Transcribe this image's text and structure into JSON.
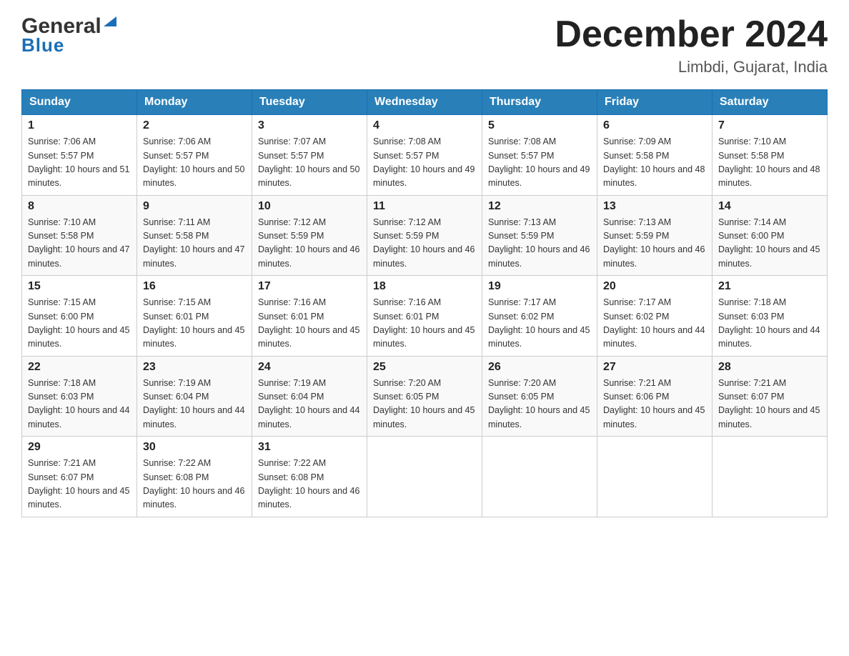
{
  "header": {
    "logo": {
      "general": "General",
      "blue": "Blue"
    },
    "month_title": "December 2024",
    "location": "Limbdi, Gujarat, India"
  },
  "days_of_week": [
    "Sunday",
    "Monday",
    "Tuesday",
    "Wednesday",
    "Thursday",
    "Friday",
    "Saturday"
  ],
  "weeks": [
    [
      {
        "day": "1",
        "sunrise": "7:06 AM",
        "sunset": "5:57 PM",
        "daylight": "10 hours and 51 minutes."
      },
      {
        "day": "2",
        "sunrise": "7:06 AM",
        "sunset": "5:57 PM",
        "daylight": "10 hours and 50 minutes."
      },
      {
        "day": "3",
        "sunrise": "7:07 AM",
        "sunset": "5:57 PM",
        "daylight": "10 hours and 50 minutes."
      },
      {
        "day": "4",
        "sunrise": "7:08 AM",
        "sunset": "5:57 PM",
        "daylight": "10 hours and 49 minutes."
      },
      {
        "day": "5",
        "sunrise": "7:08 AM",
        "sunset": "5:57 PM",
        "daylight": "10 hours and 49 minutes."
      },
      {
        "day": "6",
        "sunrise": "7:09 AM",
        "sunset": "5:58 PM",
        "daylight": "10 hours and 48 minutes."
      },
      {
        "day": "7",
        "sunrise": "7:10 AM",
        "sunset": "5:58 PM",
        "daylight": "10 hours and 48 minutes."
      }
    ],
    [
      {
        "day": "8",
        "sunrise": "7:10 AM",
        "sunset": "5:58 PM",
        "daylight": "10 hours and 47 minutes."
      },
      {
        "day": "9",
        "sunrise": "7:11 AM",
        "sunset": "5:58 PM",
        "daylight": "10 hours and 47 minutes."
      },
      {
        "day": "10",
        "sunrise": "7:12 AM",
        "sunset": "5:59 PM",
        "daylight": "10 hours and 46 minutes."
      },
      {
        "day": "11",
        "sunrise": "7:12 AM",
        "sunset": "5:59 PM",
        "daylight": "10 hours and 46 minutes."
      },
      {
        "day": "12",
        "sunrise": "7:13 AM",
        "sunset": "5:59 PM",
        "daylight": "10 hours and 46 minutes."
      },
      {
        "day": "13",
        "sunrise": "7:13 AM",
        "sunset": "5:59 PM",
        "daylight": "10 hours and 46 minutes."
      },
      {
        "day": "14",
        "sunrise": "7:14 AM",
        "sunset": "6:00 PM",
        "daylight": "10 hours and 45 minutes."
      }
    ],
    [
      {
        "day": "15",
        "sunrise": "7:15 AM",
        "sunset": "6:00 PM",
        "daylight": "10 hours and 45 minutes."
      },
      {
        "day": "16",
        "sunrise": "7:15 AM",
        "sunset": "6:01 PM",
        "daylight": "10 hours and 45 minutes."
      },
      {
        "day": "17",
        "sunrise": "7:16 AM",
        "sunset": "6:01 PM",
        "daylight": "10 hours and 45 minutes."
      },
      {
        "day": "18",
        "sunrise": "7:16 AM",
        "sunset": "6:01 PM",
        "daylight": "10 hours and 45 minutes."
      },
      {
        "day": "19",
        "sunrise": "7:17 AM",
        "sunset": "6:02 PM",
        "daylight": "10 hours and 45 minutes."
      },
      {
        "day": "20",
        "sunrise": "7:17 AM",
        "sunset": "6:02 PM",
        "daylight": "10 hours and 44 minutes."
      },
      {
        "day": "21",
        "sunrise": "7:18 AM",
        "sunset": "6:03 PM",
        "daylight": "10 hours and 44 minutes."
      }
    ],
    [
      {
        "day": "22",
        "sunrise": "7:18 AM",
        "sunset": "6:03 PM",
        "daylight": "10 hours and 44 minutes."
      },
      {
        "day": "23",
        "sunrise": "7:19 AM",
        "sunset": "6:04 PM",
        "daylight": "10 hours and 44 minutes."
      },
      {
        "day": "24",
        "sunrise": "7:19 AM",
        "sunset": "6:04 PM",
        "daylight": "10 hours and 44 minutes."
      },
      {
        "day": "25",
        "sunrise": "7:20 AM",
        "sunset": "6:05 PM",
        "daylight": "10 hours and 45 minutes."
      },
      {
        "day": "26",
        "sunrise": "7:20 AM",
        "sunset": "6:05 PM",
        "daylight": "10 hours and 45 minutes."
      },
      {
        "day": "27",
        "sunrise": "7:21 AM",
        "sunset": "6:06 PM",
        "daylight": "10 hours and 45 minutes."
      },
      {
        "day": "28",
        "sunrise": "7:21 AM",
        "sunset": "6:07 PM",
        "daylight": "10 hours and 45 minutes."
      }
    ],
    [
      {
        "day": "29",
        "sunrise": "7:21 AM",
        "sunset": "6:07 PM",
        "daylight": "10 hours and 45 minutes."
      },
      {
        "day": "30",
        "sunrise": "7:22 AM",
        "sunset": "6:08 PM",
        "daylight": "10 hours and 46 minutes."
      },
      {
        "day": "31",
        "sunrise": "7:22 AM",
        "sunset": "6:08 PM",
        "daylight": "10 hours and 46 minutes."
      },
      null,
      null,
      null,
      null
    ]
  ],
  "labels": {
    "sunrise": "Sunrise:",
    "sunset": "Sunset:",
    "daylight": "Daylight:"
  }
}
